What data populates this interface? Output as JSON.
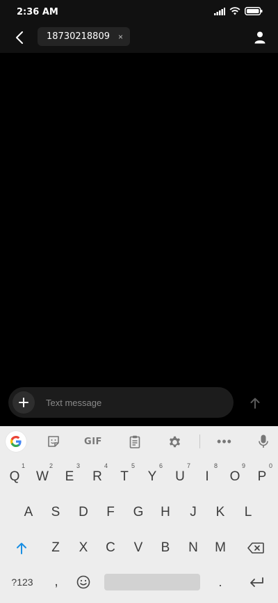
{
  "status_bar": {
    "time": "2:36 AM"
  },
  "header": {
    "recipient": "18730218809",
    "chip_close": "×"
  },
  "compose": {
    "placeholder": "Text message"
  },
  "keyboard": {
    "toolbar": {
      "gif_label": "GIF",
      "more_label": "•••"
    },
    "row1": [
      {
        "key": "Q",
        "hint": "1"
      },
      {
        "key": "W",
        "hint": "2"
      },
      {
        "key": "E",
        "hint": "3"
      },
      {
        "key": "R",
        "hint": "4"
      },
      {
        "key": "T",
        "hint": "5"
      },
      {
        "key": "Y",
        "hint": "6"
      },
      {
        "key": "U",
        "hint": "7"
      },
      {
        "key": "I",
        "hint": "8"
      },
      {
        "key": "O",
        "hint": "9"
      },
      {
        "key": "P",
        "hint": "0"
      }
    ],
    "row2": [
      "A",
      "S",
      "D",
      "F",
      "G",
      "H",
      "J",
      "K",
      "L"
    ],
    "row3": [
      "Z",
      "X",
      "C",
      "V",
      "B",
      "N",
      "M"
    ],
    "symbols_label": "?123",
    "comma_label": ","
  },
  "colors": {
    "accent_blue": "#1a8fe3",
    "keyboard_bg": "#ededed",
    "chip_bg": "#242424"
  }
}
